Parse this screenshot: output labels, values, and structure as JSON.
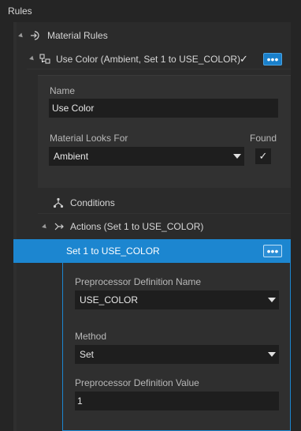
{
  "header": {
    "title": "Rules"
  },
  "tree": {
    "material_rules": {
      "label": "Material Rules",
      "icon": "arrow-into-icon"
    },
    "use_color_rule": {
      "label": "Use Color (Ambient, Set 1 to USE_COLOR)",
      "icon": "rule-nodes-icon",
      "check": "✓",
      "menu": "•••",
      "details": {
        "name_label": "Name",
        "name_value": "Use Color",
        "looks_for_label": "Material Looks For",
        "looks_for_value": "Ambient",
        "found_label": "Found",
        "found_check": "✓"
      }
    },
    "conditions": {
      "label": "Conditions",
      "icon": "conditions-icon"
    },
    "actions": {
      "label": "Actions (Set 1 to USE_COLOR)",
      "icon": "action-arrow-icon"
    },
    "selected_action": {
      "label": "Set 1 to USE_COLOR",
      "menu": "•••",
      "details": {
        "pp_name_label": "Preprocessor Definition Name",
        "pp_name_value": "USE_COLOR",
        "method_label": "Method",
        "method_value": "Set",
        "pp_value_label": "Preprocessor Definition Value",
        "pp_value_value": "1"
      }
    }
  },
  "colors": {
    "accent": "#1c86d0",
    "background": "#252525",
    "panel": "#2b2b2b",
    "input": "#1e1e1e"
  }
}
